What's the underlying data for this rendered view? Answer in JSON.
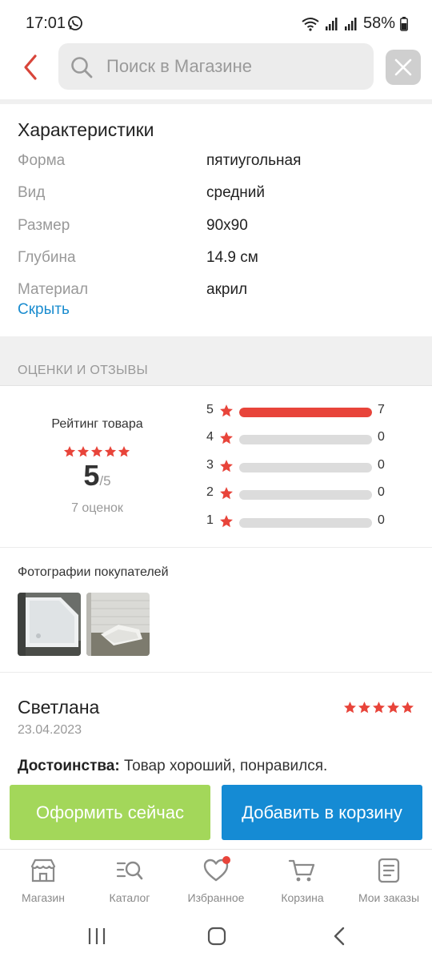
{
  "status": {
    "time": "17:01",
    "battery": "58%"
  },
  "search": {
    "placeholder": "Поиск в Магазине"
  },
  "specs": {
    "title": "Характеристики",
    "rows": [
      {
        "label": "Форма",
        "value": "пятиугольная"
      },
      {
        "label": "Вид",
        "value": "средний"
      },
      {
        "label": "Размер",
        "value": "90x90"
      },
      {
        "label": "Глубина",
        "value": "14.9 см"
      },
      {
        "label": "Материал",
        "value": "акрил"
      }
    ],
    "hide_link": "Скрыть"
  },
  "reviews_section": {
    "title": "ОЦЕНКИ И ОТЗЫВЫ"
  },
  "rating": {
    "title": "Рейтинг товара",
    "value": "5",
    "max": "/5",
    "count_label": "7 оценок",
    "stars": 5,
    "distribution": [
      {
        "stars": "5",
        "count": "7",
        "fraction": 1.0
      },
      {
        "stars": "4",
        "count": "0",
        "fraction": 0
      },
      {
        "stars": "3",
        "count": "0",
        "fraction": 0
      },
      {
        "stars": "2",
        "count": "0",
        "fraction": 0
      },
      {
        "stars": "1",
        "count": "0",
        "fraction": 0
      }
    ]
  },
  "photos": {
    "title": "Фотографии покупателей",
    "count": 2
  },
  "review": {
    "author": "Светлана",
    "date": "23.04.2023",
    "stars": 5,
    "pros_label": "Достоинства:",
    "pros_text": " Товар хороший, понравился."
  },
  "actions": {
    "order_label": "Оформить сейчас",
    "cart_label": "Добавить в корзину"
  },
  "nav": {
    "items": [
      {
        "label": "Магазин",
        "icon": "store-icon"
      },
      {
        "label": "Каталог",
        "icon": "catalog-search-icon"
      },
      {
        "label": "Избранное",
        "icon": "heart-icon"
      },
      {
        "label": "Корзина",
        "icon": "cart-icon"
      },
      {
        "label": "Мои заказы",
        "icon": "orders-icon"
      }
    ]
  },
  "colors": {
    "accent_red": "#e8443a",
    "order_green": "#a3d75a",
    "cart_blue": "#158bd4",
    "link_blue": "#1a8ccf"
  }
}
